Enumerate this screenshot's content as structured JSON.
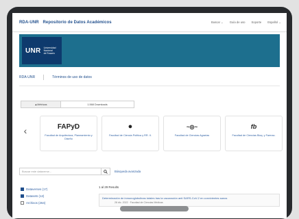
{
  "header": {
    "brand_short": "RDA-UNR",
    "brand_title": "Repositorio de Datos Académicos",
    "nav": [
      {
        "label": "Buscar ⌄"
      },
      {
        "label": "Guía de uso"
      },
      {
        "label": "Soporte"
      },
      {
        "label": "Español ⌄"
      }
    ]
  },
  "hero": {
    "logo_text": "UNR",
    "logo_subtitle": [
      "Universidad",
      "Nacional",
      "de Rosario"
    ]
  },
  "breadcrumb": {
    "home": "RDA-UNR",
    "terms": "Términos de uso de datos"
  },
  "metrics_tabs": [
    {
      "label": "▲Métricas",
      "active": true
    },
    {
      "label": "1.568 Downloads",
      "active": false
    }
  ],
  "carousel": {
    "prev_arrow": "‹",
    "cards": [
      {
        "icon_text": "FAPyD",
        "icon": "fapyd-logo",
        "label": "Facultad de Arquitectura, Planeamiento y Diseño"
      },
      {
        "icon_text": "●",
        "icon": "globe-logo",
        "label": "Facultad de Ciencia Política y RR. II."
      },
      {
        "icon_text": "~◎~",
        "icon": "agrarias-logo",
        "label": "Facultad de Ciencias Agrarias"
      },
      {
        "icon_text": "fb",
        "icon": "bioquimica-logo",
        "label": "Facultad de Ciencias Bioq. y Farmac."
      }
    ]
  },
  "search": {
    "placeholder": "Buscar este dataverse...",
    "button_icon": "search-icon",
    "advanced_label": "Búsqueda avanzada"
  },
  "filters": [
    {
      "label": "Dataverses (17)",
      "checked": true
    },
    {
      "label": "Datasets (12)",
      "checked": true
    },
    {
      "label": "Archivos (264)",
      "checked": false
    }
  ],
  "results": {
    "count_label": "1 al 29 Results",
    "items": [
      {
        "title": "Determinación de inmunoglobulinas totales tras la vacunación anti SARS-CoV-2 en convivientes sanos",
        "meta": "28 dic. 2022 · Facultad de Ciencias Médicas"
      }
    ]
  }
}
